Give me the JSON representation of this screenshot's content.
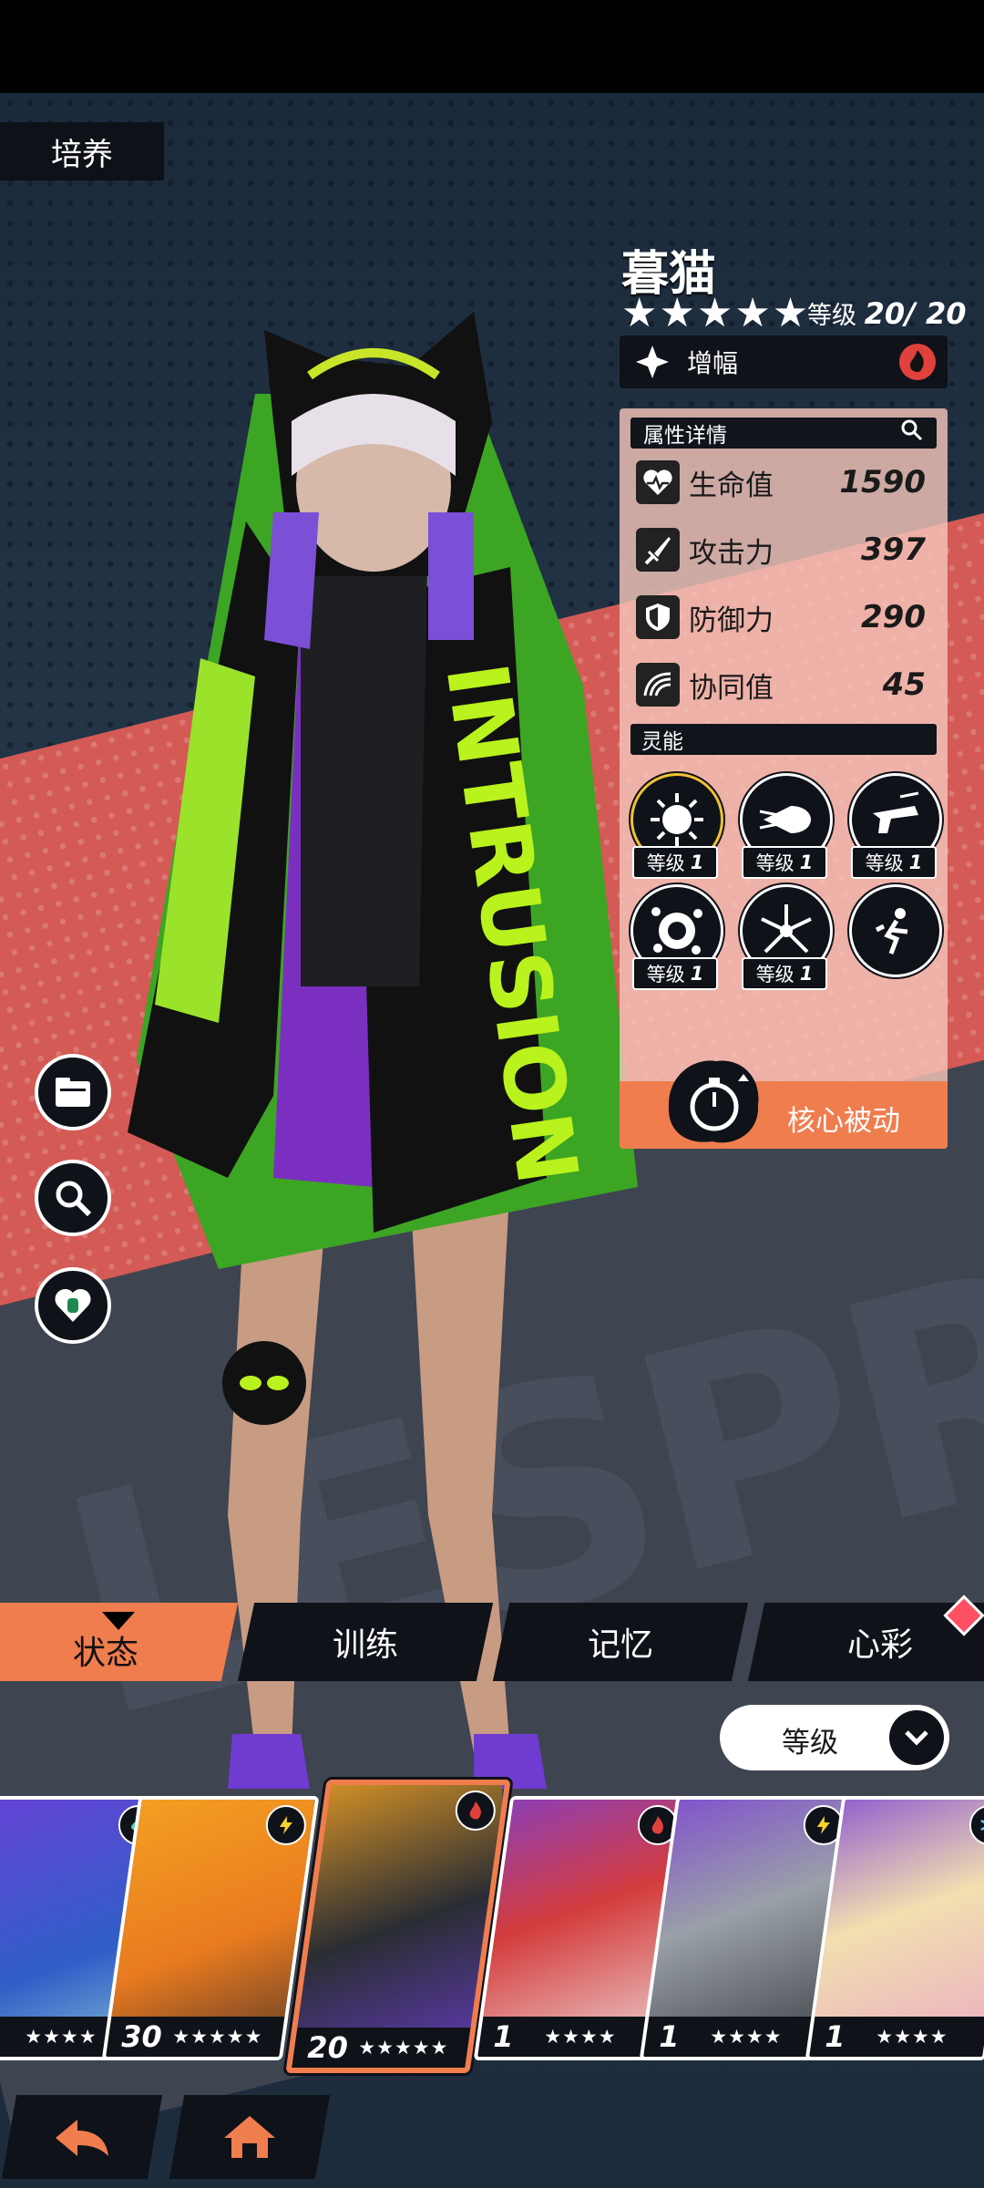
{
  "page": {
    "section_title": "培养"
  },
  "character": {
    "name": "暮猫",
    "stars": "★★★★★",
    "level_label": "等级",
    "level_value": "20/ 20",
    "element_label": "增幅"
  },
  "panel": {
    "header": "属性详情",
    "stats": [
      {
        "label": "生命值",
        "value": "1590",
        "icon": "heart-pulse-icon"
      },
      {
        "label": "攻击力",
        "value": "397",
        "icon": "sword-icon"
      },
      {
        "label": "防御力",
        "value": "290",
        "icon": "shield-icon"
      },
      {
        "label": "协同值",
        "value": "45",
        "icon": "wave-icon"
      }
    ],
    "skills_header": "灵能",
    "skills": [
      {
        "level_label": "等级",
        "level": "1"
      },
      {
        "level_label": "等级",
        "level": "1"
      },
      {
        "level_label": "等级",
        "level": "1"
      },
      {
        "level_label": "等级",
        "level": "1"
      },
      {
        "level_label": "等级",
        "level": "1"
      }
    ],
    "core_label": "核心被动"
  },
  "tabs": [
    {
      "label": "状态"
    },
    {
      "label": "训练"
    },
    {
      "label": "记忆"
    },
    {
      "label": "心彩"
    }
  ],
  "sort": {
    "label": "等级"
  },
  "roster": [
    {
      "level": "",
      "stars": "★★★★",
      "element": "wind"
    },
    {
      "level": "30",
      "stars": "★★★★★",
      "element": "thunder"
    },
    {
      "level": "20",
      "stars": "★★★★★",
      "element": "fire"
    },
    {
      "level": "1",
      "stars": "★★★★",
      "element": "fire"
    },
    {
      "level": "1",
      "stars": "★★★★",
      "element": "thunder"
    },
    {
      "level": "1",
      "stars": "★★★★",
      "element": "ice"
    }
  ],
  "colors": {
    "accent": "#f07d4e",
    "panel_bg": "#f4c5ba",
    "dark": "#0f1219",
    "red_band": "#d35a55",
    "highlight_gold": "#f1c232"
  }
}
